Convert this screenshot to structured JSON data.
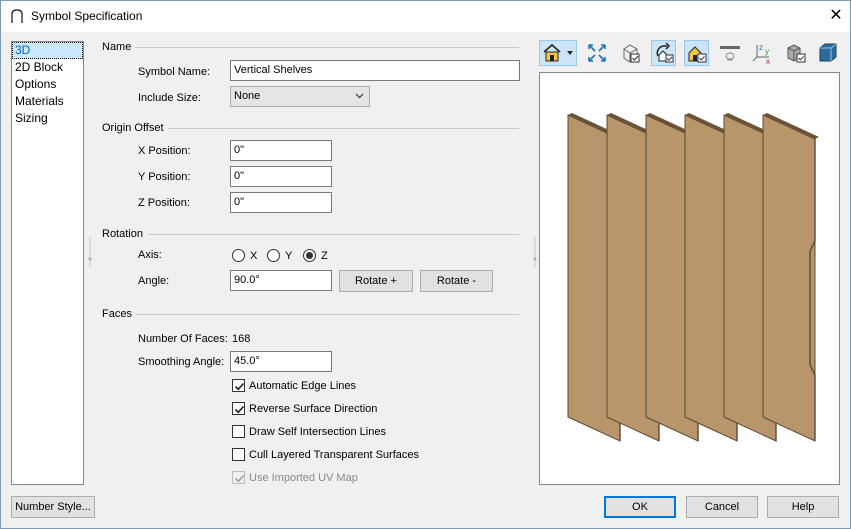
{
  "window": {
    "title": "Symbol Specification",
    "close_glyph": "✕"
  },
  "nav": {
    "items": [
      "3D",
      "2D Block",
      "Options",
      "Materials",
      "Sizing"
    ],
    "selected": "3D"
  },
  "name_section": {
    "heading": "Name",
    "symbol_name_label": "Symbol Name:",
    "symbol_name_value": "Vertical Shelves",
    "include_size_label": "Include Size:",
    "include_size_value": "None"
  },
  "origin_section": {
    "heading": "Origin Offset",
    "x_label": "X Position:",
    "x_value": "0\"",
    "y_label": "Y Position:",
    "y_value": "0\"",
    "z_label": "Z Position:",
    "z_value": "0\""
  },
  "rotation_section": {
    "heading": "Rotation",
    "axis_label": "Axis:",
    "axis_options": [
      "X",
      "Y",
      "Z"
    ],
    "axis_selected": "Z",
    "angle_label": "Angle:",
    "angle_value": "90.0°",
    "rotate_plus": "Rotate +",
    "rotate_minus": "Rotate -"
  },
  "faces_section": {
    "heading": "Faces",
    "num_faces_label": "Number Of Faces:",
    "num_faces_value": "168",
    "smoothing_label": "Smoothing Angle:",
    "smoothing_value": "45.0°",
    "checkboxes": [
      {
        "label": "Automatic Edge Lines",
        "checked": true,
        "disabled": false
      },
      {
        "label": "Reverse Surface Direction",
        "checked": true,
        "disabled": false
      },
      {
        "label": "Draw Self Intersection Lines",
        "checked": false,
        "disabled": false
      },
      {
        "label": "Cull Layered Transparent Surfaces",
        "checked": false,
        "disabled": false
      },
      {
        "label": "Use Imported UV Map",
        "checked": true,
        "disabled": true
      }
    ]
  },
  "toolbar": {
    "icons": [
      "render-mode-icon",
      "fit-view-icon",
      "wireframe-icon",
      "rotate-view-icon",
      "show-origin-icon",
      "floor-plane-icon",
      "axes-icon",
      "boxed-view-icon",
      "cube-view-icon"
    ],
    "axis_letters": [
      "z",
      "y",
      "x"
    ]
  },
  "footer": {
    "number_style": "Number Style...",
    "ok": "OK",
    "cancel": "Cancel",
    "help": "Help"
  },
  "colors": {
    "shelf_face": "#b8956a",
    "shelf_edge": "#5c4a32",
    "accent": "#0078d7"
  }
}
